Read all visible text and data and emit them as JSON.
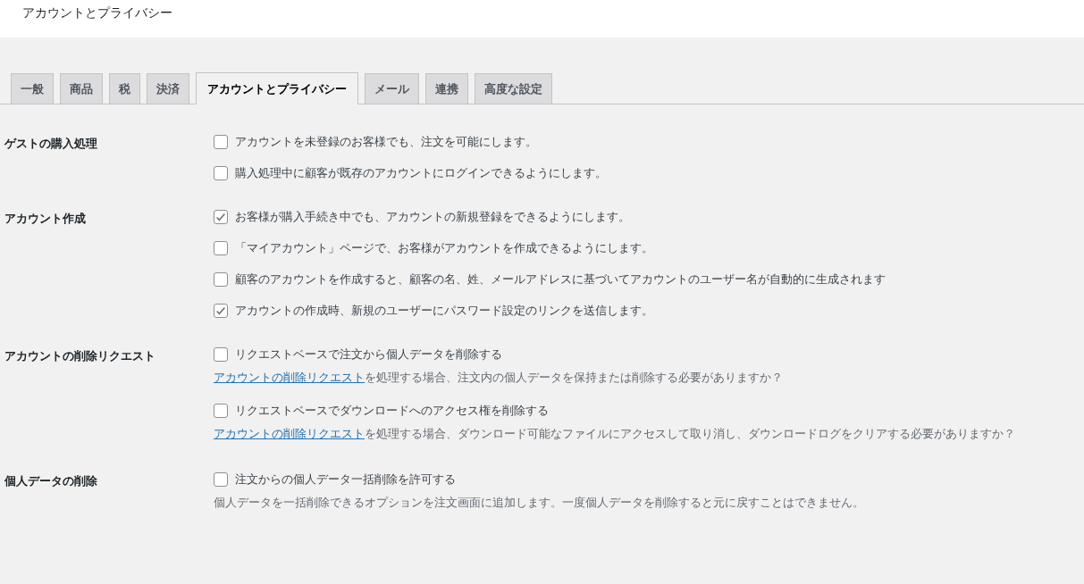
{
  "header": {
    "title": "アカウントとプライバシー"
  },
  "tabs": [
    {
      "label": "一般",
      "selected": false
    },
    {
      "label": "商品",
      "selected": false
    },
    {
      "label": "税",
      "selected": false
    },
    {
      "label": "決済",
      "selected": false
    },
    {
      "label": "アカウントとプライバシー",
      "selected": true
    },
    {
      "label": "メール",
      "selected": false
    },
    {
      "label": "連携",
      "selected": false
    },
    {
      "label": "高度な設定",
      "selected": false
    }
  ],
  "sections": [
    {
      "label": "ゲストの購入処理",
      "items": [
        {
          "kind": "checkbox",
          "label": "アカウントを未登録のお客様でも、注文を可能にします。",
          "checked": false
        },
        {
          "kind": "checkbox",
          "label": "購入処理中に顧客が既存のアカウントにログインできるようにします。",
          "checked": false
        }
      ]
    },
    {
      "label": "アカウント作成",
      "items": [
        {
          "kind": "checkbox",
          "label": "お客様が購入手続き中でも、アカウントの新規登録をできるようにします。",
          "checked": true
        },
        {
          "kind": "checkbox",
          "label": "「マイアカウント」ページで、お客様がアカウントを作成できるようにします。",
          "checked": false
        },
        {
          "kind": "checkbox",
          "label": "顧客のアカウントを作成すると、顧客の名、姓、メールアドレスに基づいてアカウントのユーザー名が自動的に生成されます",
          "checked": false
        },
        {
          "kind": "checkbox",
          "label": "アカウントの作成時、新規のユーザーにパスワード設定のリンクを送信します。",
          "checked": true
        }
      ]
    },
    {
      "label": "アカウントの削除リクエスト",
      "items": [
        {
          "kind": "checkbox",
          "label": "リクエストベースで注文から個人データを削除する",
          "checked": false
        },
        {
          "kind": "description",
          "link": "アカウントの削除リクエスト",
          "text": "を処理する場合、注文内の個人データを保持または削除する必要がありますか？"
        },
        {
          "kind": "checkbox",
          "label": "リクエストベースでダウンロードへのアクセス権を削除する",
          "checked": false
        },
        {
          "kind": "description",
          "link": "アカウントの削除リクエスト",
          "text": "を処理する場合、ダウンロード可能なファイルにアクセスして取り消し、ダウンロードログをクリアする必要がありますか？"
        }
      ]
    },
    {
      "label": "個人データの削除",
      "items": [
        {
          "kind": "checkbox",
          "label": "注文からの個人データ一括削除を許可する",
          "checked": false
        },
        {
          "kind": "description",
          "text": "個人データを一括削除できるオプションを注文画面に追加します。一度個人データを削除すると元に戻すことはできません。"
        }
      ]
    }
  ]
}
